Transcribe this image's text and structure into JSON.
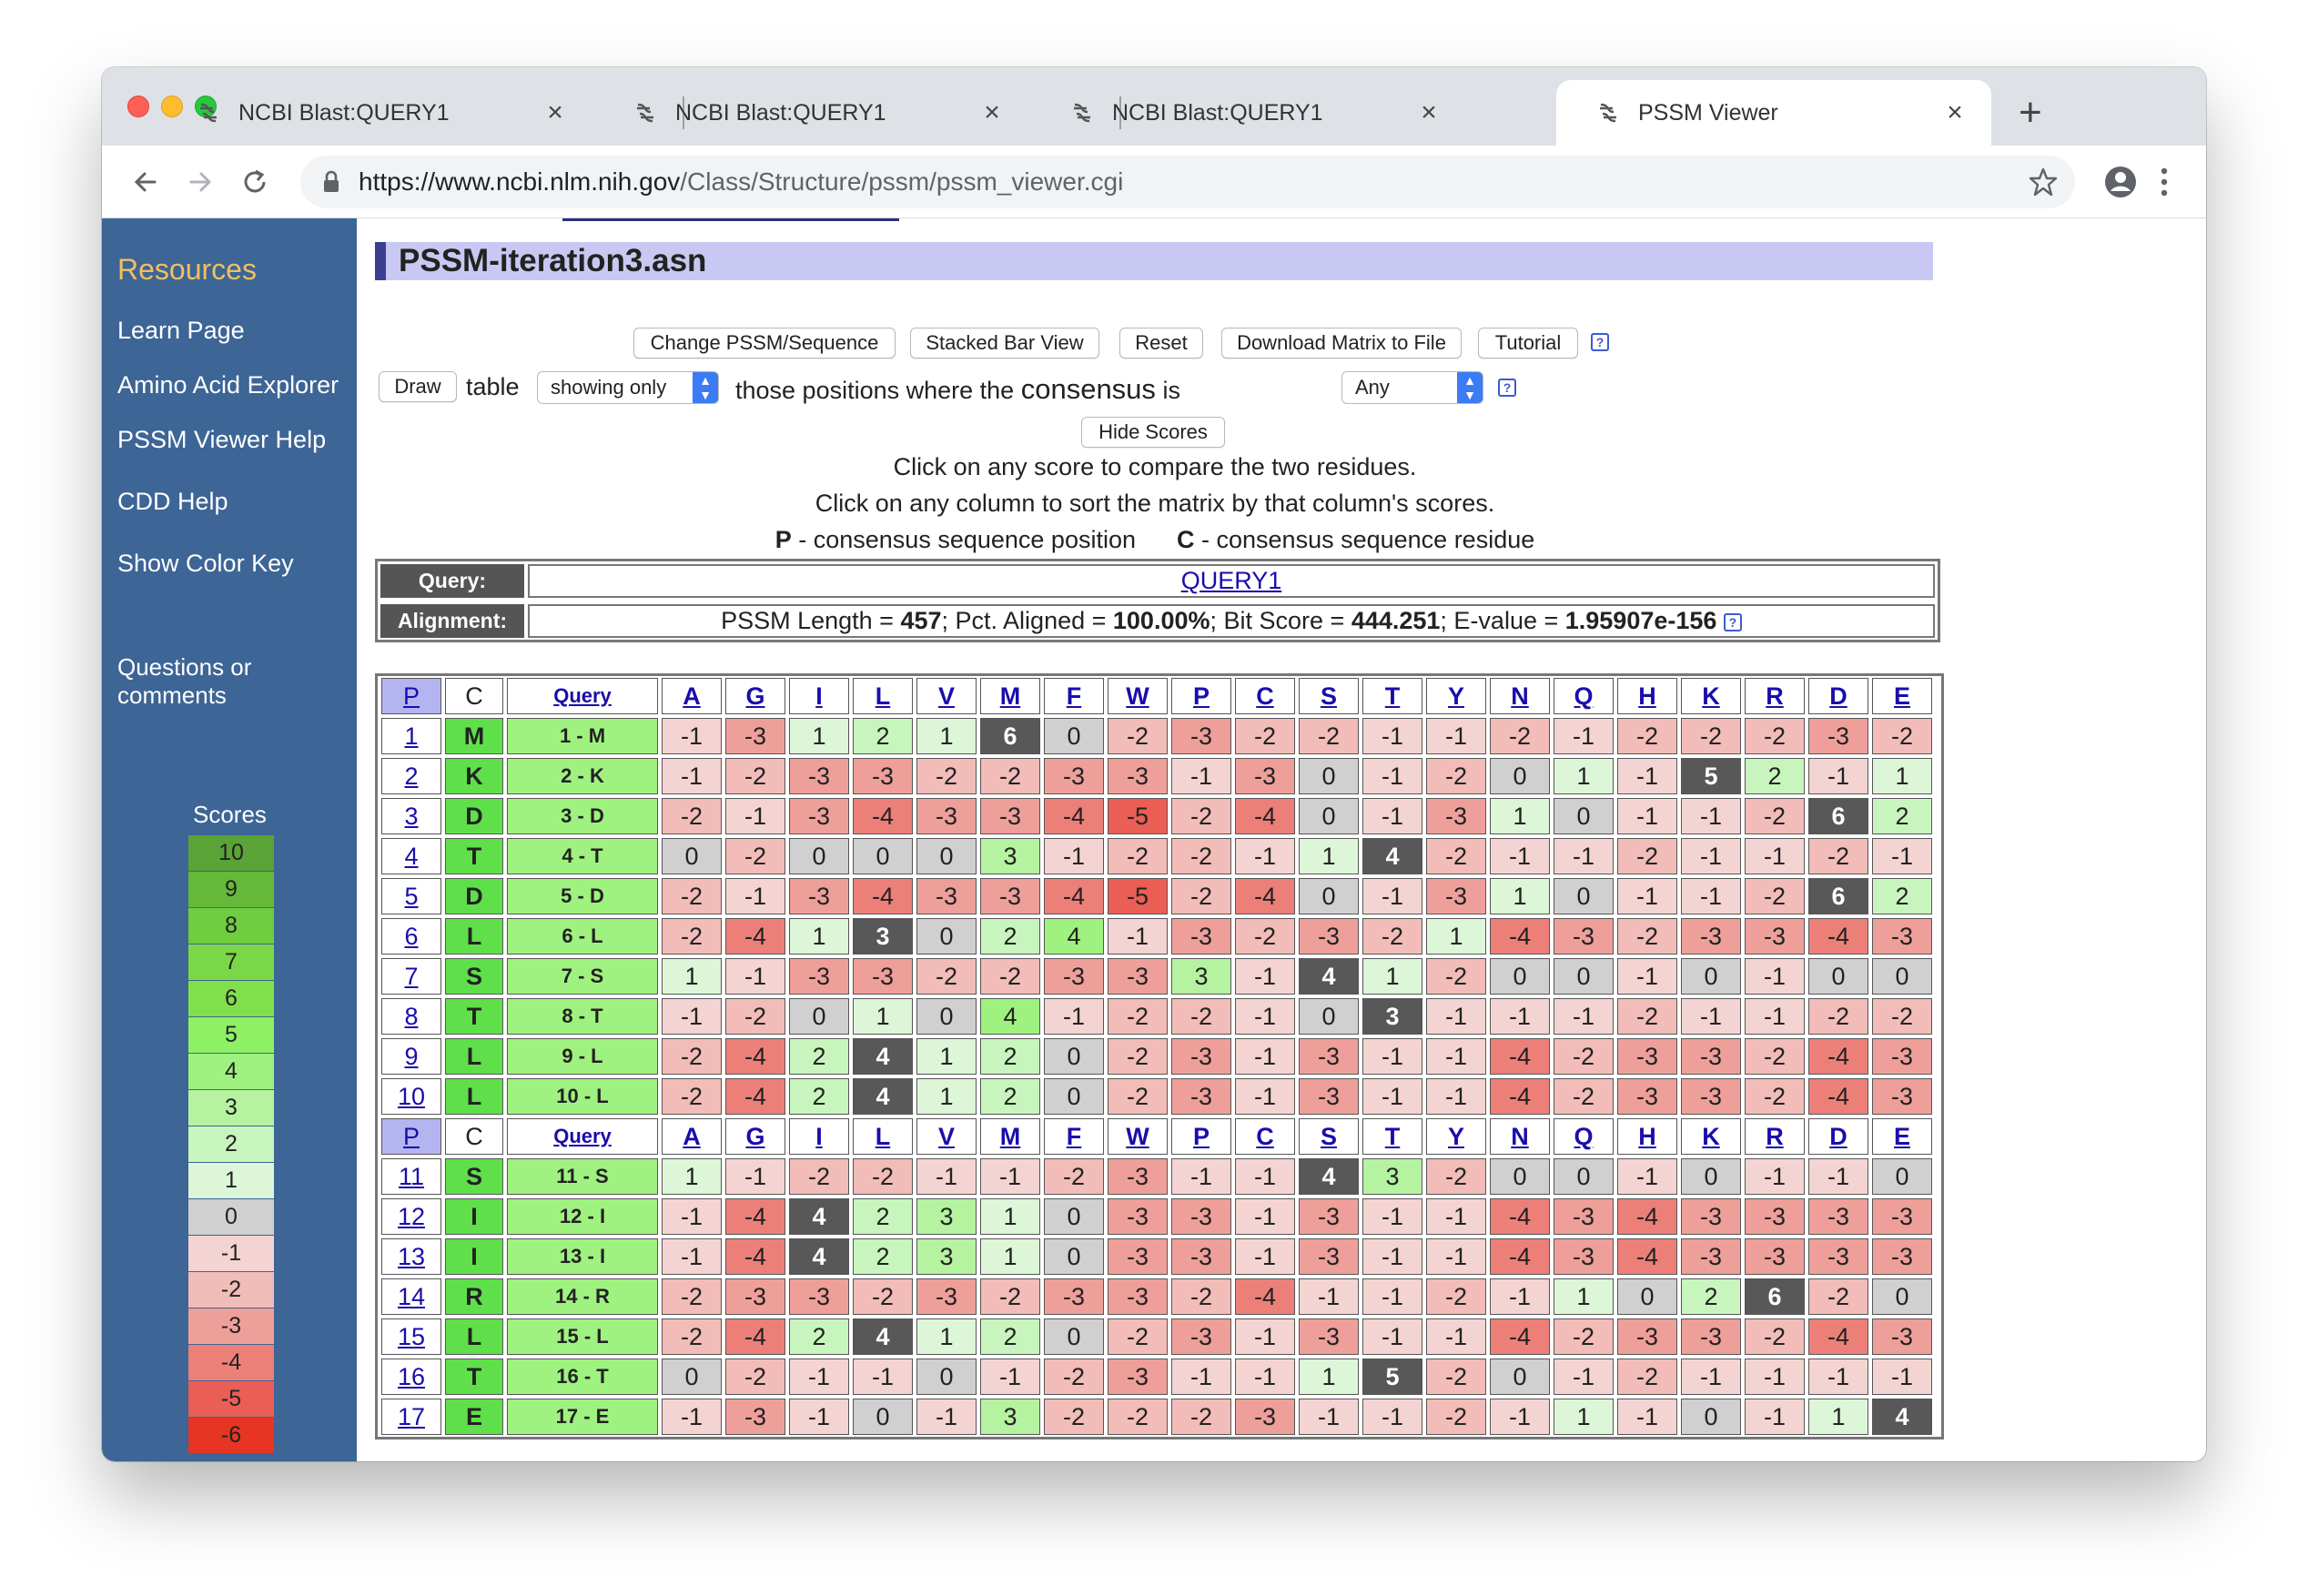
{
  "browser": {
    "tabs": [
      {
        "title": "NCBI Blast:QUERY1",
        "active": false
      },
      {
        "title": "NCBI Blast:QUERY1",
        "active": false
      },
      {
        "title": "NCBI Blast:QUERY1",
        "active": false
      },
      {
        "title": "PSSM Viewer",
        "active": true
      }
    ],
    "close_glyph": "×",
    "new_tab_glyph": "+",
    "url_host": "https://www.ncbi.nlm.nih.gov",
    "url_path": "/Class/Structure/pssm/pssm_viewer.cgi"
  },
  "sidebar": {
    "title": "Resources",
    "links": [
      "Learn Page",
      "Amino Acid Explorer",
      "PSSM Viewer Help",
      "CDD Help",
      "Show Color Key"
    ],
    "questions": "Questions or comments",
    "scores_title": "Scores",
    "score_key": [
      {
        "label": "10",
        "color": "#5aa336"
      },
      {
        "label": "9",
        "color": "#66b83b"
      },
      {
        "label": "8",
        "color": "#6fcd3f"
      },
      {
        "label": "7",
        "color": "#7ad846"
      },
      {
        "label": "6",
        "color": "#7fe04a"
      },
      {
        "label": "5",
        "color": "#8ef063"
      },
      {
        "label": "4",
        "color": "#9ff27f"
      },
      {
        "label": "3",
        "color": "#b5f3a1"
      },
      {
        "label": "2",
        "color": "#c8f5bd"
      },
      {
        "label": "1",
        "color": "#dcf6d7"
      },
      {
        "label": "0",
        "color": "#d0d0d0"
      },
      {
        "label": "-1",
        "color": "#f4d4d2"
      },
      {
        "label": "-2",
        "color": "#f2bcb8"
      },
      {
        "label": "-3",
        "color": "#ef9f9a"
      },
      {
        "label": "-4",
        "color": "#ec8079"
      },
      {
        "label": "-5",
        "color": "#ea5e55"
      },
      {
        "label": "-6",
        "color": "#e63522"
      }
    ]
  },
  "page": {
    "title": "PSSM-iteration3.asn",
    "buttons": {
      "change": "Change PSSM/Sequence",
      "stacked": "Stacked Bar View",
      "reset": "Reset",
      "download": "Download Matrix to File",
      "tutorial": "Tutorial",
      "draw": "Draw",
      "hide_scores": "Hide Scores"
    },
    "help_glyph": "?",
    "draw_table_word": "table",
    "showing_value": "showing only",
    "positions_text_1": "those positions where the",
    "positions_text_2": "consensus",
    "positions_text_3": "is",
    "consensus_value": "Any",
    "instruction_1": "Click on any score to compare the two residues.",
    "instruction_2": "Click on any column to sort the matrix by that column's scores.",
    "legend_p_letter": "P",
    "legend_p_text": " - consensus sequence position",
    "legend_c_letter": "C",
    "legend_c_text": " - consensus sequence residue"
  },
  "info": {
    "query_label": "Query:",
    "query_value": "QUERY1",
    "alignment_label": "Alignment:",
    "pssm_length_label": "PSSM Length = ",
    "pssm_length": "457",
    "pct_label": "; Pct. Aligned = ",
    "pct_aligned": "100.00%",
    "bit_label": "; Bit Score = ",
    "bit_score": "444.251",
    "evalue_label": "; E-value = ",
    "evalue": "1.95907e-156"
  },
  "matrix": {
    "header_p": "P",
    "header_c": "C",
    "header_query": "Query",
    "residues": [
      "A",
      "G",
      "I",
      "L",
      "V",
      "M",
      "F",
      "W",
      "P",
      "C",
      "S",
      "T",
      "Y",
      "N",
      "Q",
      "H",
      "K",
      "R",
      "D",
      "E"
    ],
    "rows": [
      {
        "pos": "1",
        "cons": "M",
        "query": "1 - M",
        "scores": [
          -1,
          -3,
          1,
          2,
          1,
          6,
          0,
          -2,
          -3,
          -2,
          -2,
          -1,
          -1,
          -2,
          -1,
          -2,
          -2,
          -2,
          -3,
          -2
        ]
      },
      {
        "pos": "2",
        "cons": "K",
        "query": "2 - K",
        "scores": [
          -1,
          -2,
          -3,
          -3,
          -2,
          -2,
          -3,
          -3,
          -1,
          -3,
          0,
          -1,
          -2,
          0,
          1,
          -1,
          5,
          2,
          -1,
          1
        ]
      },
      {
        "pos": "3",
        "cons": "D",
        "query": "3 - D",
        "scores": [
          -2,
          -1,
          -3,
          -4,
          -3,
          -3,
          -4,
          -5,
          -2,
          -4,
          0,
          -1,
          -3,
          1,
          0,
          -1,
          -1,
          -2,
          6,
          2
        ]
      },
      {
        "pos": "4",
        "cons": "T",
        "query": "4 - T",
        "scores": [
          0,
          -2,
          0,
          0,
          0,
          3,
          -1,
          -2,
          -2,
          -1,
          1,
          4,
          -2,
          -1,
          -1,
          -2,
          -1,
          -1,
          -2,
          -1
        ]
      },
      {
        "pos": "5",
        "cons": "D",
        "query": "5 - D",
        "scores": [
          -2,
          -1,
          -3,
          -4,
          -3,
          -3,
          -4,
          -5,
          -2,
          -4,
          0,
          -1,
          -3,
          1,
          0,
          -1,
          -1,
          -2,
          6,
          2
        ]
      },
      {
        "pos": "6",
        "cons": "L",
        "query": "6 - L",
        "scores": [
          -2,
          -4,
          1,
          3,
          0,
          2,
          4,
          -1,
          -3,
          -2,
          -3,
          -2,
          1,
          -4,
          -3,
          -2,
          -3,
          -3,
          -4,
          -3
        ]
      },
      {
        "pos": "7",
        "cons": "S",
        "query": "7 - S",
        "scores": [
          1,
          -1,
          -3,
          -3,
          -2,
          -2,
          -3,
          -3,
          3,
          -1,
          4,
          1,
          -2,
          0,
          0,
          -1,
          0,
          -1,
          0,
          0
        ]
      },
      {
        "pos": "8",
        "cons": "T",
        "query": "8 - T",
        "scores": [
          -1,
          -2,
          0,
          1,
          0,
          4,
          -1,
          -2,
          -2,
          -1,
          0,
          3,
          -1,
          -1,
          -1,
          -2,
          -1,
          -1,
          -2,
          -2
        ]
      },
      {
        "pos": "9",
        "cons": "L",
        "query": "9 - L",
        "scores": [
          -2,
          -4,
          2,
          4,
          1,
          2,
          0,
          -2,
          -3,
          -1,
          -3,
          -1,
          -1,
          -4,
          -2,
          -3,
          -3,
          -2,
          -4,
          -3
        ]
      },
      {
        "pos": "10",
        "cons": "L",
        "query": "10 - L",
        "scores": [
          -2,
          -4,
          2,
          4,
          1,
          2,
          0,
          -2,
          -3,
          -1,
          -3,
          -1,
          -1,
          -4,
          -2,
          -3,
          -3,
          -2,
          -4,
          -3
        ]
      },
      {
        "header": true
      },
      {
        "pos": "11",
        "cons": "S",
        "query": "11 - S",
        "scores": [
          1,
          -1,
          -2,
          -2,
          -1,
          -1,
          -2,
          -3,
          -1,
          -1,
          4,
          3,
          -2,
          0,
          0,
          -1,
          0,
          -1,
          -1,
          0
        ]
      },
      {
        "pos": "12",
        "cons": "I",
        "query": "12 - I",
        "scores": [
          -1,
          -4,
          4,
          2,
          3,
          1,
          0,
          -3,
          -3,
          -1,
          -3,
          -1,
          -1,
          -4,
          -3,
          -4,
          -3,
          -3,
          -3,
          -3
        ]
      },
      {
        "pos": "13",
        "cons": "I",
        "query": "13 - I",
        "scores": [
          -1,
          -4,
          4,
          2,
          3,
          1,
          0,
          -3,
          -3,
          -1,
          -3,
          -1,
          -1,
          -4,
          -3,
          -4,
          -3,
          -3,
          -3,
          -3
        ]
      },
      {
        "pos": "14",
        "cons": "R",
        "query": "14 - R",
        "scores": [
          -2,
          -3,
          -3,
          -2,
          -3,
          -2,
          -3,
          -3,
          -2,
          -4,
          -1,
          -1,
          -2,
          -1,
          1,
          0,
          2,
          6,
          -2,
          0
        ]
      },
      {
        "pos": "15",
        "cons": "L",
        "query": "15 - L",
        "scores": [
          -2,
          -4,
          2,
          4,
          1,
          2,
          0,
          -2,
          -3,
          -1,
          -3,
          -1,
          -1,
          -4,
          -2,
          -3,
          -3,
          -2,
          -4,
          -3
        ]
      },
      {
        "pos": "16",
        "cons": "T",
        "query": "16 - T",
        "scores": [
          0,
          -2,
          -1,
          -1,
          0,
          -1,
          -2,
          -3,
          -1,
          -1,
          1,
          5,
          -2,
          0,
          -1,
          -2,
          -1,
          -1,
          -1,
          -1
        ]
      },
      {
        "pos": "17",
        "cons": "E",
        "query": "17 - E",
        "scores": [
          -1,
          -3,
          -1,
          0,
          -1,
          3,
          -2,
          -2,
          -2,
          -3,
          -1,
          -1,
          -2,
          -1,
          1,
          -1,
          0,
          -1,
          1,
          4
        ]
      }
    ]
  }
}
